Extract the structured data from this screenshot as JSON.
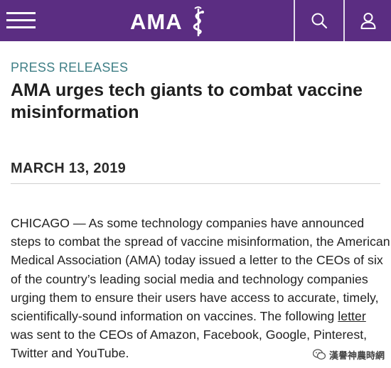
{
  "header": {
    "logo_text": "AMA",
    "menu_icon": "hamburger-menu-icon",
    "search_icon": "search-icon",
    "user_icon": "user-icon",
    "brand_color": "#5b2d82"
  },
  "article": {
    "section_label": "PRESS RELEASES",
    "title": "AMA urges tech giants to combat vaccine misinformation",
    "date": "MARCH 13, 2019",
    "body_before_link": "CHICAGO — As some technology companies have announced steps to combat the spread of vaccine misinformation, the American Medical Association (AMA) today issued a letter to the CEOs of six of the country’s leading social media and technology companies urging them to ensure their users have access to accurate, timely, scientifically-sound information on vaccines. The following ",
    "body_link": "letter",
    "body_after_link": " was sent to the CEOs of Amazon, Facebook, Google, Pinterest, Twitter and YouTube."
  },
  "colors": {
    "section_label": "#3f7f86",
    "text": "#222222"
  },
  "watermark": {
    "text": "漢譽神農時網"
  }
}
